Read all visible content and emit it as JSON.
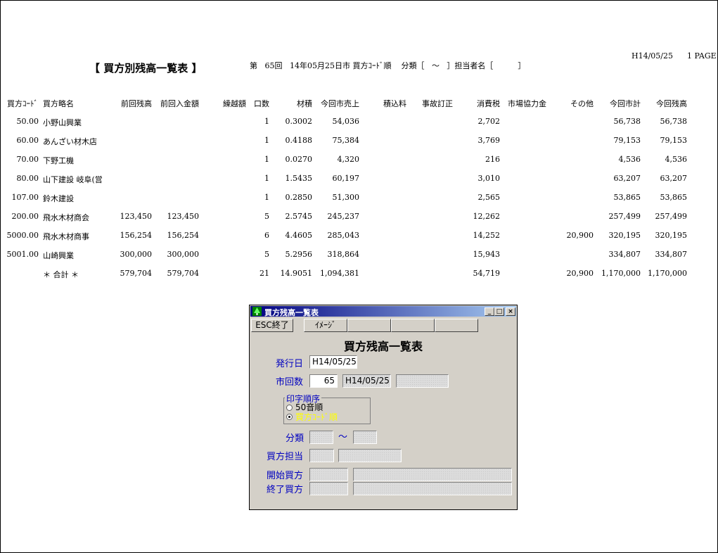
{
  "report": {
    "date": "H14/05/25",
    "page": "1 PAGE",
    "title": "【 買方別残高一覧表 】",
    "header_info": "第   65回   14年05月25日市 買方ｺｰﾄﾞ順    分類［   ～   ］担当者名［          ］"
  },
  "table": {
    "headers": [
      "買方ｺｰﾄﾞ",
      "買方略名",
      "前回残高",
      "前回入金額",
      "繰越額",
      "口数",
      "材積",
      "今回市売上",
      "積込料",
      "事故訂正",
      "消費税",
      "市場協力金",
      "その他",
      "今回市計",
      "今回残高"
    ],
    "rows": [
      [
        "50.00",
        "小野山興業",
        "",
        "",
        "",
        "1",
        "0.3002",
        "54,036",
        "",
        "",
        "2,702",
        "",
        "",
        "56,738",
        "56,738"
      ],
      [
        "60.00",
        "あんざい材木店",
        "",
        "",
        "",
        "1",
        "0.4188",
        "75,384",
        "",
        "",
        "3,769",
        "",
        "",
        "79,153",
        "79,153"
      ],
      [
        "70.00",
        "下野工機",
        "",
        "",
        "",
        "1",
        "0.0270",
        "4,320",
        "",
        "",
        "216",
        "",
        "",
        "4,536",
        "4,536"
      ],
      [
        "80.00",
        "山下建設 岐阜(営",
        "",
        "",
        "",
        "1",
        "1.5435",
        "60,197",
        "",
        "",
        "3,010",
        "",
        "",
        "63,207",
        "63,207"
      ],
      [
        "107.00",
        "鈴木建設",
        "",
        "",
        "",
        "1",
        "0.2850",
        "51,300",
        "",
        "",
        "2,565",
        "",
        "",
        "53,865",
        "53,865"
      ],
      [
        "200.00",
        "飛水木材商会",
        "123,450",
        "123,450",
        "",
        "5",
        "2.5745",
        "245,237",
        "",
        "",
        "12,262",
        "",
        "",
        "257,499",
        "257,499"
      ],
      [
        "5000.00",
        "飛水木材商事",
        "156,254",
        "156,254",
        "",
        "6",
        "4.4605",
        "285,043",
        "",
        "",
        "14,252",
        "",
        "20,900",
        "320,195",
        "320,195"
      ],
      [
        "5001.00",
        "山崎興業",
        "300,000",
        "300,000",
        "",
        "5",
        "5.2956",
        "318,864",
        "",
        "",
        "15,943",
        "",
        "",
        "334,807",
        "334,807"
      ],
      [
        "",
        "＊ 合計 ＊",
        "579,704",
        "579,704",
        "",
        "21",
        "14.9051",
        "1,094,381",
        "",
        "",
        "54,719",
        "",
        "20,900",
        "1,170,000",
        "1,170,000"
      ]
    ]
  },
  "dialog": {
    "window_title": "買方残高一覧表",
    "esc_button": "ESC終了",
    "image_button": "ｲﾒｰｼﾞ",
    "heading": "買方残高一覧表",
    "issue_date_label": "発行日",
    "issue_date_value": "H14/05/25",
    "round_label": "市回数",
    "round_value": "65",
    "round_date": "H14/05/25",
    "print_order_label": "印字順序",
    "order_options": [
      "50音順",
      "買方ｺｰﾄﾞ順"
    ],
    "selected_option": "買方ｺｰﾄﾞ順",
    "category_label": "分類",
    "category_sep": "～",
    "buyer_staff_label": "買方担当",
    "start_buyer_label": "開始買方",
    "end_buyer_label": "終了買方",
    "minimize": "_",
    "maximize": "□",
    "close": "×"
  },
  "colors": {
    "label_blue": "#0000c0",
    "selected_option": "#ffff00",
    "title_bar": "#000080"
  }
}
